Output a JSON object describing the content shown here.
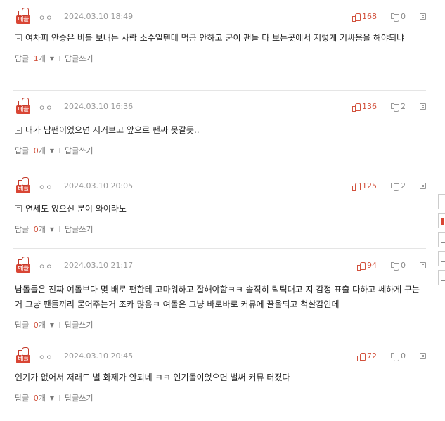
{
  "badge_label": "베플",
  "reply_label": "답글",
  "write_reply_label": "답글쓰기",
  "comments": [
    {
      "nick": "ㅇㅇ",
      "date": "2024.03.10 18:49",
      "up": "168",
      "down": "0",
      "text": "여차피 안좋은 버블 보내는 사람 소수일텐데 먹금 안하고 굳이 팬들 다 보는곳에서 저렇게 기싸움을 해야되냐",
      "reply_count": "1",
      "reply_suffix": "개",
      "has_doc_icon": true
    },
    {
      "nick": "ㅇㅇ",
      "date": "2024.03.10 16:36",
      "up": "136",
      "down": "2",
      "text": "내가 남팬이었으면 저거보고 앞으로 팬싸 못갈듯..",
      "reply_count": "0",
      "reply_suffix": "개",
      "has_doc_icon": true
    },
    {
      "nick": "ㅇㅇ",
      "date": "2024.03.10 20:05",
      "up": "125",
      "down": "2",
      "text": "연세도 있으신 분이 와이라노",
      "reply_count": "0",
      "reply_suffix": "개",
      "has_doc_icon": true
    },
    {
      "nick": "ㅇㅇ",
      "date": "2024.03.10 21:17",
      "up": "94",
      "down": "0",
      "text": "남돌들은 진짜 여돌보다 몇 배로 팬한테 고마워하고 잘해야함ㅋㅋ 솔직히 틱틱대고 지 감정 표출 다하고 쎄하게 구는거 그냥 팬들끼리 묻어주는거 조카 많음ㅋ 여돌은 그냥 바로바로 커뮤에 끌올되고 척살감인데",
      "reply_count": "0",
      "reply_suffix": "개",
      "has_doc_icon": false
    },
    {
      "nick": "ㅇㅇ",
      "date": "2024.03.10 20:45",
      "up": "72",
      "down": "0",
      "text": "인기가 없어서 저래도 별 화제가 안되네 ㅋㅋ 인기돌이었으면 벌써 커뮤 터졌다",
      "reply_count": "0",
      "reply_suffix": "개",
      "has_doc_icon": false
    }
  ],
  "colors": {
    "accent": "#d2513c",
    "badge": "#d94534"
  }
}
